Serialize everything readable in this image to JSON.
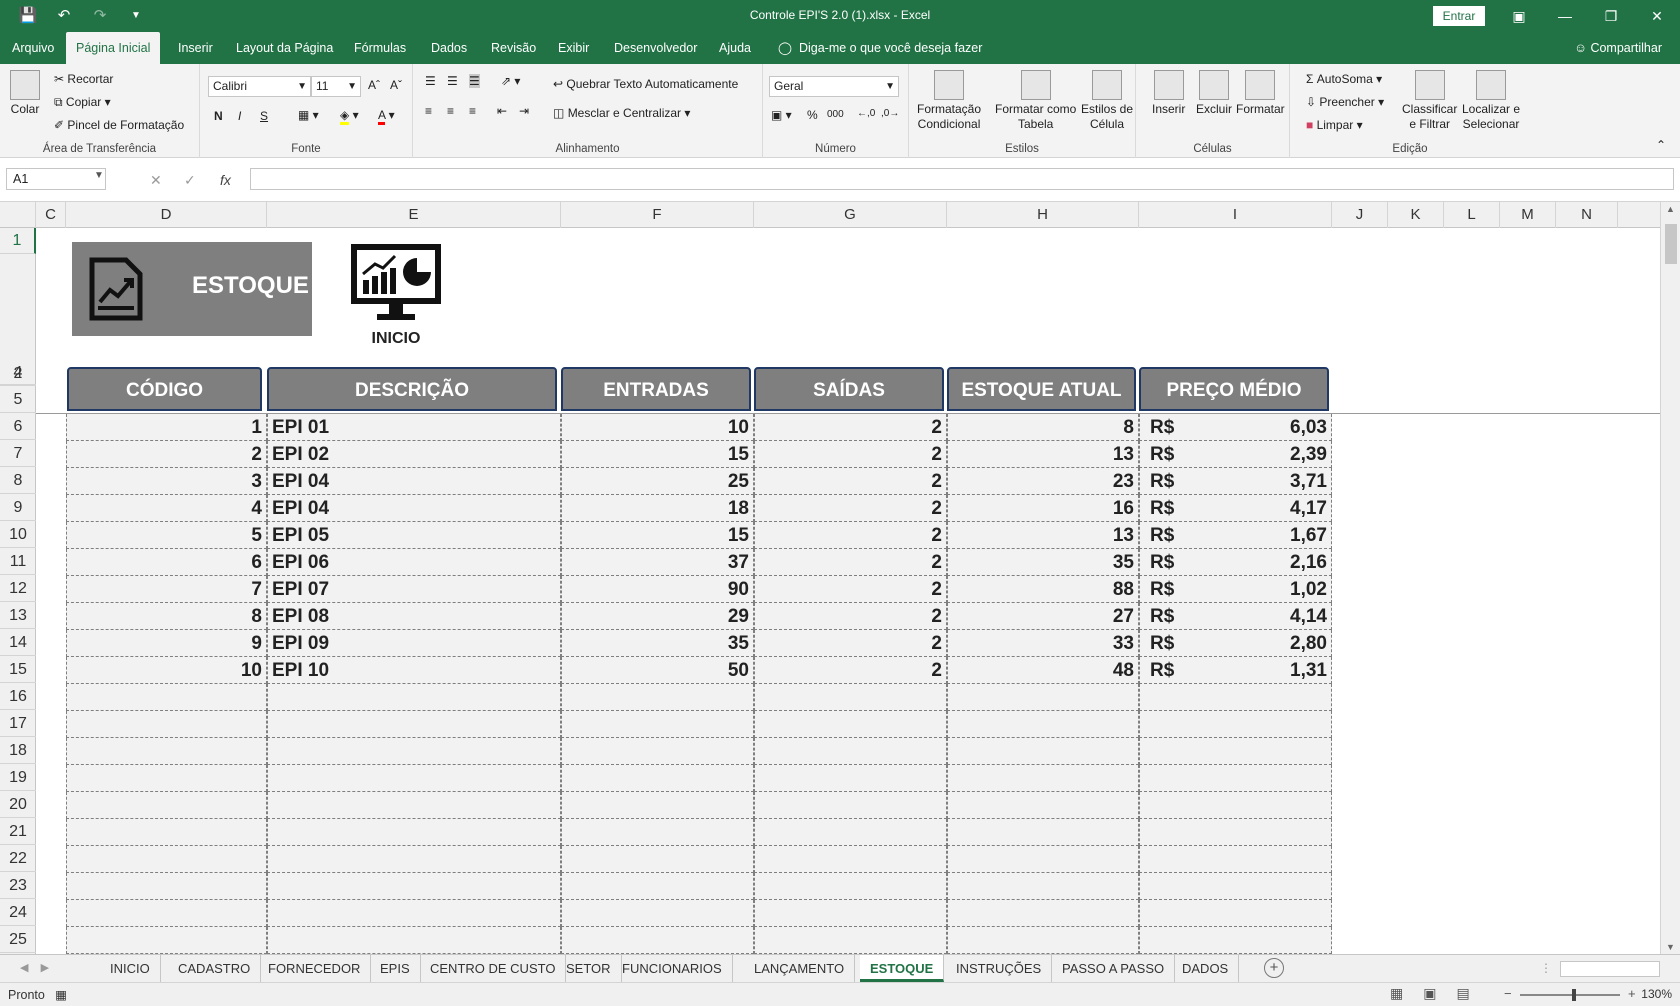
{
  "window": {
    "title": "Controle EPI'S 2.0 (1).xlsx  -  Excel",
    "signin": "Entrar",
    "qat_icons": [
      "save-icon",
      "undo-icon",
      "redo-icon",
      "customize-icon"
    ]
  },
  "menu": {
    "tabs": [
      "Arquivo",
      "Página Inicial",
      "Inserir",
      "Layout da Página",
      "Fórmulas",
      "Dados",
      "Revisão",
      "Exibir",
      "Desenvolvedor",
      "Ajuda"
    ],
    "active": "Página Inicial",
    "tell_me": "Diga-me o que você deseja fazer",
    "share": "Compartilhar"
  },
  "ribbon": {
    "clipboard": {
      "label": "Área de Transferência",
      "paste": "Colar",
      "cut": "Recortar",
      "copy": "Copiar",
      "format_painter": "Pincel de Formatação"
    },
    "font": {
      "label": "Fonte",
      "name": "Calibri",
      "size": "11",
      "bold": "N",
      "italic": "I",
      "underline": "S"
    },
    "alignment": {
      "label": "Alinhamento",
      "wrap": "Quebrar Texto Automaticamente",
      "merge": "Mesclar e Centralizar"
    },
    "number": {
      "label": "Número",
      "format": "Geral",
      "percent": "%",
      "thousands": "000"
    },
    "styles": {
      "label": "Estilos",
      "conditional": "Formatação\nCondicional",
      "as_table": "Formatar como\nTabela",
      "cell_styles": "Estilos de\nCélula"
    },
    "cells": {
      "label": "Células",
      "insert": "Inserir",
      "delete": "Excluir",
      "format": "Formatar"
    },
    "editing": {
      "label": "Edição",
      "autosum": "AutoSoma",
      "fill": "Preencher",
      "clear": "Limpar",
      "sort": "Classificar\ne Filtrar",
      "find": "Localizar e\nSelecionar"
    }
  },
  "formula": {
    "namebox": "A1",
    "value": ""
  },
  "columns": [
    "C",
    "D",
    "E",
    "F",
    "G",
    "H",
    "I",
    "J",
    "K",
    "L",
    "M",
    "N"
  ],
  "rows": [
    "1",
    "2",
    "4",
    "5",
    "6",
    "7",
    "8",
    "9",
    "10",
    "11",
    "12",
    "13",
    "14",
    "15",
    "16",
    "17",
    "18",
    "19",
    "20",
    "21",
    "22",
    "23",
    "24",
    "25"
  ],
  "banner": {
    "title": "ESTOQUE",
    "inicio": "INICIO"
  },
  "table": {
    "headers": [
      "CÓDIGO",
      "DESCRIÇÃO",
      "ENTRADAS",
      "SAÍDAS",
      "ESTOQUE ATUAL",
      "PREÇO MÉDIO"
    ],
    "currency": "R$",
    "rows": [
      {
        "codigo": "1",
        "descricao": "EPI 01",
        "entradas": "10",
        "saidas": "2",
        "estoque": "8",
        "preco": "6,03"
      },
      {
        "codigo": "2",
        "descricao": "EPI 02",
        "entradas": "15",
        "saidas": "2",
        "estoque": "13",
        "preco": "2,39"
      },
      {
        "codigo": "3",
        "descricao": "EPI 04",
        "entradas": "25",
        "saidas": "2",
        "estoque": "23",
        "preco": "3,71"
      },
      {
        "codigo": "4",
        "descricao": "EPI 04",
        "entradas": "18",
        "saidas": "2",
        "estoque": "16",
        "preco": "4,17"
      },
      {
        "codigo": "5",
        "descricao": "EPI 05",
        "entradas": "15",
        "saidas": "2",
        "estoque": "13",
        "preco": "1,67"
      },
      {
        "codigo": "6",
        "descricao": "EPI 06",
        "entradas": "37",
        "saidas": "2",
        "estoque": "35",
        "preco": "2,16"
      },
      {
        "codigo": "7",
        "descricao": "EPI 07",
        "entradas": "90",
        "saidas": "2",
        "estoque": "88",
        "preco": "1,02"
      },
      {
        "codigo": "8",
        "descricao": "EPI 08",
        "entradas": "29",
        "saidas": "2",
        "estoque": "27",
        "preco": "4,14"
      },
      {
        "codigo": "9",
        "descricao": "EPI 09",
        "entradas": "35",
        "saidas": "2",
        "estoque": "33",
        "preco": "2,80"
      },
      {
        "codigo": "10",
        "descricao": "EPI 10",
        "entradas": "50",
        "saidas": "2",
        "estoque": "48",
        "preco": "1,31"
      }
    ]
  },
  "sheets": [
    "INICIO",
    "CADASTRO",
    "FORNECEDOR",
    "EPIS",
    "CENTRO DE CUSTO",
    "SETOR",
    "FUNCIONARIOS",
    "LANÇAMENTO",
    "ESTOQUE",
    "INSTRUÇÕES",
    "PASSO A PASSO",
    "DADOS"
  ],
  "active_sheet": "ESTOQUE",
  "status": {
    "text": "Pronto",
    "zoom": "130%"
  }
}
